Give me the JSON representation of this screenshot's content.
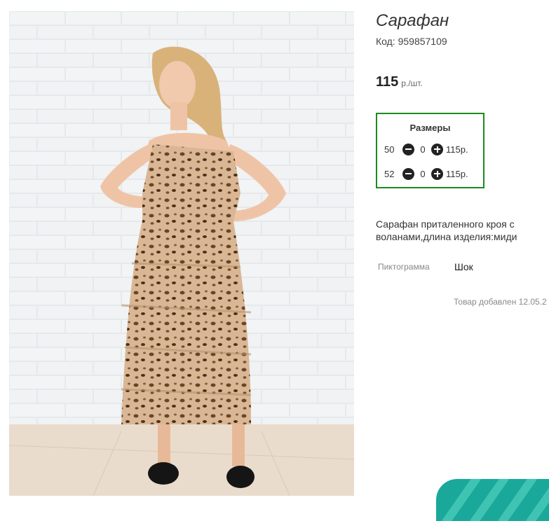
{
  "product": {
    "title": "Сарафан",
    "code": "Код: 959857109",
    "price": {
      "value": "115",
      "unit": "р./шт."
    },
    "image_description_icon": "product-photo"
  },
  "sizes": {
    "heading": "Размеры",
    "rows": [
      {
        "size": "50",
        "qty": "0",
        "sum": "115р."
      },
      {
        "size": "52",
        "qty": "0",
        "sum": "115р."
      }
    ]
  },
  "description": "Сарафан приталенного кроя с воланами,длина изделия:миди",
  "attributes": [
    {
      "label": "Пиктограмма",
      "value": "Шок"
    }
  ],
  "added": "Товар добавлен 12.05.2",
  "colors": {
    "border_accent": "#1e8a1e",
    "widget": "#1aa89a"
  }
}
